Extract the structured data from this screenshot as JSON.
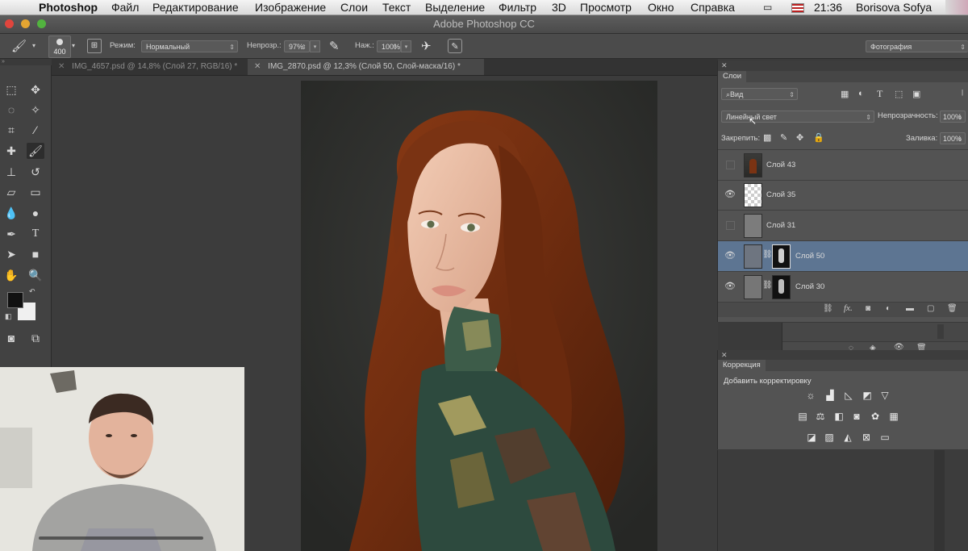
{
  "menubar": {
    "app": "Photoshop",
    "items": [
      "Файл",
      "Редактирование",
      "Изображение",
      "Слои",
      "Текст",
      "Выделение",
      "Фильтр",
      "3D",
      "Просмотр",
      "Окно",
      "Справка"
    ],
    "time": "21:36",
    "user": "Borisova Sofya"
  },
  "window": {
    "title": "Adobe Photoshop CC"
  },
  "options": {
    "brush_size": "400",
    "mode_label": "Режим:",
    "mode_value": "Нормальный",
    "opacity_label": "Непрозр.:",
    "opacity_value": "97%",
    "flow_label": "Наж.:",
    "flow_value": "100%",
    "workspace": "Фотография"
  },
  "tabs": [
    {
      "label": "IMG_4657.psd @ 14,8% (Слой 27, RGB/16) *"
    },
    {
      "label": "IMG_2870.psd @ 12,3% (Слой 50, Слой-маска/16) *"
    }
  ],
  "layers_panel": {
    "tab": "Слои",
    "filter": "Вид",
    "blend_mode": "Линейный свет",
    "opacity_label": "Непрозрачность:",
    "opacity_value": "100%",
    "lock_label": "Закрепить:",
    "fill_label": "Заливка:",
    "fill_value": "100%",
    "layers": [
      {
        "name": "Слой 43",
        "visible": false,
        "selected": false
      },
      {
        "name": "Слой 35",
        "visible": true,
        "selected": false
      },
      {
        "name": "Слой 31",
        "visible": false,
        "selected": false
      },
      {
        "name": "Слой 50",
        "visible": true,
        "selected": true
      },
      {
        "name": "Слой 30",
        "visible": true,
        "selected": false
      }
    ]
  },
  "corrections_panel": {
    "tab": "Коррекция",
    "add_label": "Добавить корректировку"
  },
  "colors": {
    "selected_layer": "#5d7592",
    "foreground": "#111111",
    "background": "#f0f0f0"
  }
}
